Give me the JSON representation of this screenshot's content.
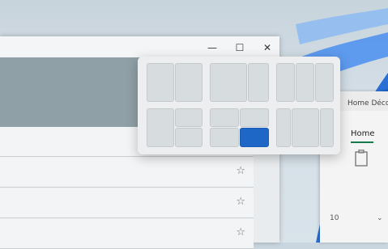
{
  "word": {
    "title": "Home Déco",
    "tab_home": "Home",
    "font_size": "10"
  },
  "snap_layouts": {
    "highlighted": "layout-5-zone-3"
  },
  "colors": {
    "accent": "#1e67c6",
    "word_green": "#1b7a4a"
  },
  "icons": {
    "minimize": "minimize-icon",
    "maximize": "maximize-icon",
    "close": "close-icon",
    "star": "star-icon"
  }
}
